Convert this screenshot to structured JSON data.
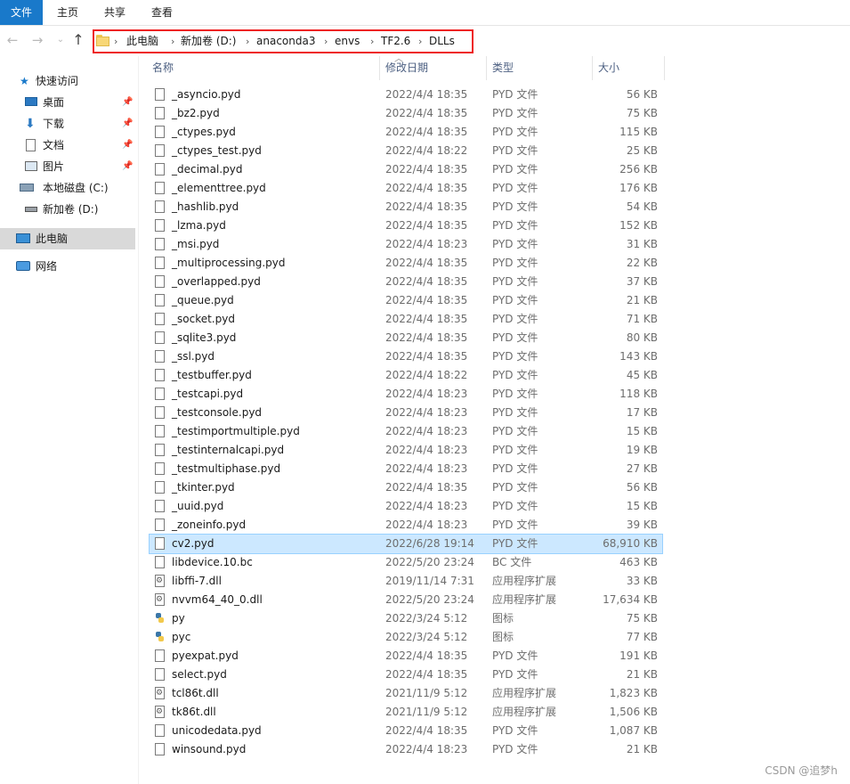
{
  "ribbon": {
    "tabs": [
      "文件",
      "主页",
      "共享",
      "查看"
    ]
  },
  "nav": {
    "back_icon": "arrow-left-icon",
    "forward_icon": "arrow-right-icon",
    "recent_icon": "chevron-down-icon",
    "up_icon": "arrow-up-icon",
    "breadcrumbs": [
      "此电脑",
      "新加卷 (D:)",
      "anaconda3",
      "envs",
      "TF2.6",
      "DLLs"
    ]
  },
  "sidebar": {
    "items": [
      {
        "label": "快速访问",
        "icon": "star-icon"
      },
      {
        "label": "桌面",
        "icon": "desktop-icon",
        "pinned": true
      },
      {
        "label": "下载",
        "icon": "download-icon",
        "pinned": true
      },
      {
        "label": "文档",
        "icon": "document-icon",
        "pinned": true
      },
      {
        "label": "图片",
        "icon": "picture-icon",
        "pinned": true
      },
      {
        "label": "本地磁盘 (C:)",
        "icon": "drive-icon"
      },
      {
        "label": "新加卷 (D:)",
        "icon": "drive-icon"
      },
      {
        "label": "此电脑",
        "icon": "computer-icon",
        "selected": true
      },
      {
        "label": "网络",
        "icon": "network-icon"
      }
    ]
  },
  "columns": {
    "name": "名称",
    "date": "修改日期",
    "type": "类型",
    "size": "大小"
  },
  "files": [
    {
      "name": "_asyncio.pyd",
      "date": "2022/4/4 18:35",
      "type": "PYD 文件",
      "size": "56 KB",
      "icon": "file"
    },
    {
      "name": "_bz2.pyd",
      "date": "2022/4/4 18:35",
      "type": "PYD 文件",
      "size": "75 KB",
      "icon": "file"
    },
    {
      "name": "_ctypes.pyd",
      "date": "2022/4/4 18:35",
      "type": "PYD 文件",
      "size": "115 KB",
      "icon": "file"
    },
    {
      "name": "_ctypes_test.pyd",
      "date": "2022/4/4 18:22",
      "type": "PYD 文件",
      "size": "25 KB",
      "icon": "file"
    },
    {
      "name": "_decimal.pyd",
      "date": "2022/4/4 18:35",
      "type": "PYD 文件",
      "size": "256 KB",
      "icon": "file"
    },
    {
      "name": "_elementtree.pyd",
      "date": "2022/4/4 18:35",
      "type": "PYD 文件",
      "size": "176 KB",
      "icon": "file"
    },
    {
      "name": "_hashlib.pyd",
      "date": "2022/4/4 18:35",
      "type": "PYD 文件",
      "size": "54 KB",
      "icon": "file"
    },
    {
      "name": "_lzma.pyd",
      "date": "2022/4/4 18:35",
      "type": "PYD 文件",
      "size": "152 KB",
      "icon": "file"
    },
    {
      "name": "_msi.pyd",
      "date": "2022/4/4 18:23",
      "type": "PYD 文件",
      "size": "31 KB",
      "icon": "file"
    },
    {
      "name": "_multiprocessing.pyd",
      "date": "2022/4/4 18:35",
      "type": "PYD 文件",
      "size": "22 KB",
      "icon": "file"
    },
    {
      "name": "_overlapped.pyd",
      "date": "2022/4/4 18:35",
      "type": "PYD 文件",
      "size": "37 KB",
      "icon": "file"
    },
    {
      "name": "_queue.pyd",
      "date": "2022/4/4 18:35",
      "type": "PYD 文件",
      "size": "21 KB",
      "icon": "file"
    },
    {
      "name": "_socket.pyd",
      "date": "2022/4/4 18:35",
      "type": "PYD 文件",
      "size": "71 KB",
      "icon": "file"
    },
    {
      "name": "_sqlite3.pyd",
      "date": "2022/4/4 18:35",
      "type": "PYD 文件",
      "size": "80 KB",
      "icon": "file"
    },
    {
      "name": "_ssl.pyd",
      "date": "2022/4/4 18:35",
      "type": "PYD 文件",
      "size": "143 KB",
      "icon": "file"
    },
    {
      "name": "_testbuffer.pyd",
      "date": "2022/4/4 18:22",
      "type": "PYD 文件",
      "size": "45 KB",
      "icon": "file"
    },
    {
      "name": "_testcapi.pyd",
      "date": "2022/4/4 18:23",
      "type": "PYD 文件",
      "size": "118 KB",
      "icon": "file"
    },
    {
      "name": "_testconsole.pyd",
      "date": "2022/4/4 18:23",
      "type": "PYD 文件",
      "size": "17 KB",
      "icon": "file"
    },
    {
      "name": "_testimportmultiple.pyd",
      "date": "2022/4/4 18:23",
      "type": "PYD 文件",
      "size": "15 KB",
      "icon": "file"
    },
    {
      "name": "_testinternalcapi.pyd",
      "date": "2022/4/4 18:23",
      "type": "PYD 文件",
      "size": "19 KB",
      "icon": "file"
    },
    {
      "name": "_testmultiphase.pyd",
      "date": "2022/4/4 18:23",
      "type": "PYD 文件",
      "size": "27 KB",
      "icon": "file"
    },
    {
      "name": "_tkinter.pyd",
      "date": "2022/4/4 18:35",
      "type": "PYD 文件",
      "size": "56 KB",
      "icon": "file"
    },
    {
      "name": "_uuid.pyd",
      "date": "2022/4/4 18:23",
      "type": "PYD 文件",
      "size": "15 KB",
      "icon": "file"
    },
    {
      "name": "_zoneinfo.pyd",
      "date": "2022/4/4 18:23",
      "type": "PYD 文件",
      "size": "39 KB",
      "icon": "file"
    },
    {
      "name": "cv2.pyd",
      "date": "2022/6/28 19:14",
      "type": "PYD 文件",
      "size": "68,910 KB",
      "icon": "file",
      "selected": true
    },
    {
      "name": "libdevice.10.bc",
      "date": "2022/5/20 23:24",
      "type": "BC 文件",
      "size": "463 KB",
      "icon": "file"
    },
    {
      "name": "libffi-7.dll",
      "date": "2019/11/14 7:31",
      "type": "应用程序扩展",
      "size": "33 KB",
      "icon": "dll"
    },
    {
      "name": "nvvm64_40_0.dll",
      "date": "2022/5/20 23:24",
      "type": "应用程序扩展",
      "size": "17,634 KB",
      "icon": "dll"
    },
    {
      "name": "py",
      "date": "2022/3/24 5:12",
      "type": "图标",
      "size": "75 KB",
      "icon": "py"
    },
    {
      "name": "pyc",
      "date": "2022/3/24 5:12",
      "type": "图标",
      "size": "77 KB",
      "icon": "py"
    },
    {
      "name": "pyexpat.pyd",
      "date": "2022/4/4 18:35",
      "type": "PYD 文件",
      "size": "191 KB",
      "icon": "file"
    },
    {
      "name": "select.pyd",
      "date": "2022/4/4 18:35",
      "type": "PYD 文件",
      "size": "21 KB",
      "icon": "file"
    },
    {
      "name": "tcl86t.dll",
      "date": "2021/11/9 5:12",
      "type": "应用程序扩展",
      "size": "1,823 KB",
      "icon": "dll"
    },
    {
      "name": "tk86t.dll",
      "date": "2021/11/9 5:12",
      "type": "应用程序扩展",
      "size": "1,506 KB",
      "icon": "dll"
    },
    {
      "name": "unicodedata.pyd",
      "date": "2022/4/4 18:35",
      "type": "PYD 文件",
      "size": "1,087 KB",
      "icon": "file"
    },
    {
      "name": "winsound.pyd",
      "date": "2022/4/4 18:23",
      "type": "PYD 文件",
      "size": "21 KB",
      "icon": "file"
    }
  ],
  "watermark": "CSDN @追梦h"
}
